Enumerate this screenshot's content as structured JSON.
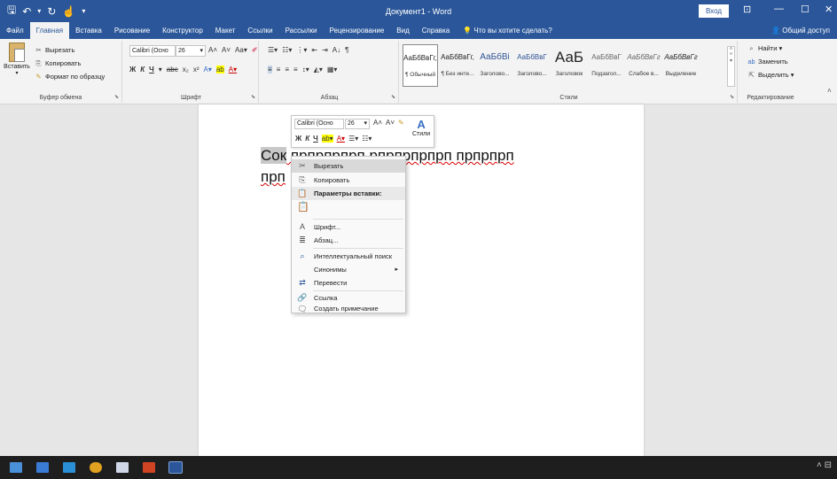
{
  "titlebar": {
    "title": "Документ1 - Word",
    "signin_label": "Вход",
    "minimize": "—",
    "maximize": "☐",
    "close": "✕",
    "ribbon_display": "⊡"
  },
  "tabs": [
    {
      "label": "Файл"
    },
    {
      "label": "Главная"
    },
    {
      "label": "Вставка"
    },
    {
      "label": "Рисование"
    },
    {
      "label": "Конструктор"
    },
    {
      "label": "Макет"
    },
    {
      "label": "Ссылки"
    },
    {
      "label": "Рассылки"
    },
    {
      "label": "Рецензирование"
    },
    {
      "label": "Вид"
    },
    {
      "label": "Справка"
    }
  ],
  "tell_me": "Что вы хотите сделать?",
  "share_label": "Общий доступ",
  "clipboard": {
    "paste": "Вставить",
    "cut": "Вырезать",
    "copy": "Копировать",
    "format_painter": "Формат по образцу",
    "group": "Буфер обмена"
  },
  "font": {
    "name": "Calibri (Осно",
    "size": "26",
    "group": "Шрифт"
  },
  "paragraph": {
    "group": "Абзац"
  },
  "styles": {
    "group": "Стили",
    "items": [
      {
        "sample": "АаБбВвГг,",
        "name": "¶ Обычный"
      },
      {
        "sample": "АаБбВвГг,",
        "name": "¶ Без инте..."
      },
      {
        "sample": "АаБбВі",
        "name": "Заголово..."
      },
      {
        "sample": "АаБбВвГ",
        "name": "Заголово..."
      },
      {
        "sample": "АаБ",
        "name": "Заголовок"
      },
      {
        "sample": "АаБбВвГ",
        "name": "Подзагол..."
      },
      {
        "sample": "АаБбВвГг",
        "name": "Слабое в..."
      },
      {
        "sample": "АаБбВвГг",
        "name": "Выделение"
      }
    ]
  },
  "editing": {
    "find": "Найти",
    "replace": "Заменить",
    "select": "Выделить",
    "group": "Редактирование"
  },
  "document": {
    "line1_selected": "Сок",
    "line1_rest": " прпрпрпрп рпрпрпрпрп прпрпрп",
    "line2": "прп"
  },
  "mini_toolbar": {
    "font": "Calibri (Осно",
    "size": "26",
    "styles": "Стили"
  },
  "context_menu": {
    "cut": "Вырезать",
    "copy": "Копировать",
    "paste_options": "Параметры вставки:",
    "font": "Шрифт...",
    "paragraph": "Абзац...",
    "smart_lookup": "Интеллектуальный поиск",
    "synonyms": "Синонимы",
    "translate": "Перевести",
    "link": "Ссылка",
    "comment": "Создать примечание"
  },
  "colors": {
    "accent": "#2b579a",
    "ribbon": "#f3f3f3",
    "taskbar": "#1e1e1e"
  }
}
